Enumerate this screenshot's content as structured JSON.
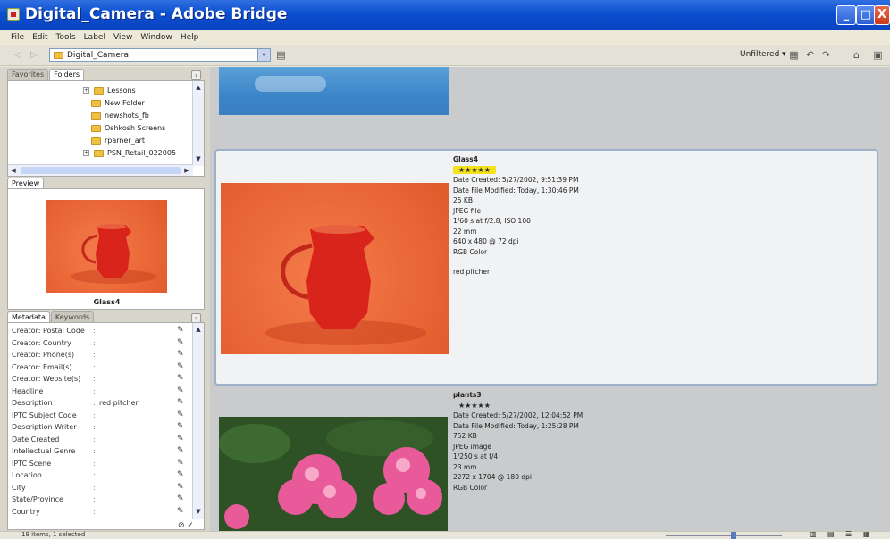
{
  "window": {
    "title": "Digital_Camera - Adobe Bridge",
    "min": "_",
    "max": "□",
    "close": "X"
  },
  "menu": [
    "File",
    "Edit",
    "Tools",
    "Label",
    "View",
    "Window",
    "Help"
  ],
  "toolbar": {
    "back": "◁",
    "forward": "▷",
    "path": "Digital_Camera",
    "dropdown": "▾",
    "filter": "Unfiltered ▾"
  },
  "folders_panel": {
    "tabs": [
      "Favorites",
      "Folders"
    ],
    "active_tab": "Folders",
    "items": [
      "Lessons",
      "New Folder",
      "newshots_fb",
      "Oshkosh Screens",
      "rparner_art",
      "PSN_Retail_022005"
    ],
    "expandable": [
      "Lessons",
      "PSN_Retail_022005"
    ]
  },
  "preview_panel": {
    "tab": "Preview",
    "caption": "Glass4"
  },
  "metadata_panel": {
    "tabs": [
      "Metadata",
      "Keywords"
    ],
    "rows": [
      {
        "key": "Creator: Postal Code",
        "value": ""
      },
      {
        "key": "Creator: Country",
        "value": ""
      },
      {
        "key": "Creator: Phone(s)",
        "value": ""
      },
      {
        "key": "Creator: Email(s)",
        "value": ""
      },
      {
        "key": "Creator: Website(s)",
        "value": ""
      },
      {
        "key": "Headline",
        "value": ""
      },
      {
        "key": "Description",
        "value": "red pitcher"
      },
      {
        "key": "IPTC Subject Code",
        "value": ""
      },
      {
        "key": "Description Writer",
        "value": ""
      },
      {
        "key": "Date Created",
        "value": ""
      },
      {
        "key": "Intellectual Genre",
        "value": ""
      },
      {
        "key": "IPTC Scene",
        "value": ""
      },
      {
        "key": "Location",
        "value": ""
      },
      {
        "key": "City",
        "value": ""
      },
      {
        "key": "State/Province",
        "value": ""
      },
      {
        "key": "Country",
        "value": ""
      }
    ]
  },
  "items": [
    {
      "name": "Glass4",
      "stars": "★★★★★",
      "details": [
        "Date Created: 5/27/2002, 9:51:39 PM",
        "Date File Modified: Today, 1:30:46 PM",
        "25 KB",
        "JPEG file",
        "1/60 s at f/2.8, ISO 100",
        "22 mm",
        "640 x 480 @ 72 dpi",
        "RGB Color",
        "",
        "red pitcher"
      ]
    },
    {
      "name": "plants3",
      "stars": "★★★★★",
      "details": [
        "Date Created: 5/27/2002, 12:04:52 PM",
        "Date File Modified: Today, 1:25:28 PM",
        "752 KB",
        "JPEG image",
        "1/250 s at f/4",
        "23 mm",
        "2272 x 1704 @ 180 dpi",
        "RGB Color"
      ]
    }
  ],
  "status": {
    "text": "19 items, 1 selected"
  },
  "colors": {
    "titlebar": "#0d4fd0",
    "rating": "#f4e21a",
    "selection_border": "#9cb0c8"
  }
}
